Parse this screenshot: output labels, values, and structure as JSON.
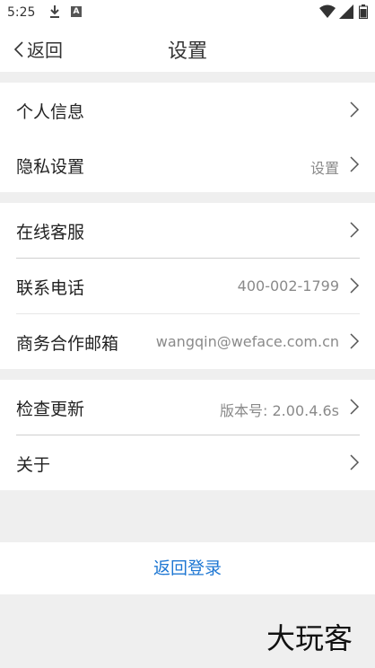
{
  "status": {
    "time": "5:25"
  },
  "nav": {
    "back_label": "返回",
    "title": "设置"
  },
  "groups": [
    [
      {
        "label": "个人信息",
        "value": ""
      },
      {
        "label": "隐私设置",
        "value": "设置"
      }
    ],
    [
      {
        "label": "在线客服",
        "value": ""
      },
      {
        "label": "联系电话",
        "value": "400-002-1799"
      },
      {
        "label": "商务合作邮箱",
        "value": "wangqin@weface.com.cn"
      }
    ],
    [
      {
        "label": "检查更新",
        "value": "版本号: 2.00.4.6s"
      },
      {
        "label": "关于",
        "value": ""
      }
    ]
  ],
  "logout_label": "返回登录",
  "watermark": "大玩客",
  "colors": {
    "accent": "#1e77d3",
    "background": "#efefef"
  }
}
